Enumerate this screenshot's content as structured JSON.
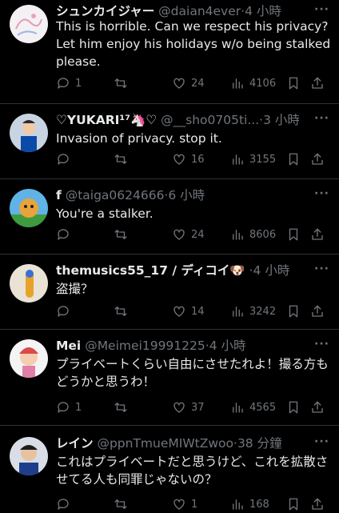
{
  "menu_glyph": "···",
  "tweets": [
    {
      "name": "シュンカイジャー",
      "handle": "@daian4ever",
      "sep": "·",
      "time": "4 小時",
      "text": "This is horrible. Can we respect his privacy? Let him enjoy his holidays w/o being stalked please.",
      "replies": "1",
      "retweets": "",
      "likes": "24",
      "views": "4106"
    },
    {
      "name": "♡YUKARI¹⁷🦄♡",
      "handle": "@__sho0705ti...",
      "sep": "·",
      "time": "3 小時",
      "text": "Invasion of privacy.  stop it.",
      "replies": "",
      "retweets": "",
      "likes": "16",
      "views": "3155"
    },
    {
      "name": "f",
      "handle": "@taiga0624666",
      "sep": "·",
      "time": "6 小時",
      "text": "You're a stalker.",
      "replies": "",
      "retweets": "",
      "likes": "24",
      "views": "8606"
    },
    {
      "name": "themusics55_17 / ディコイ🐶",
      "handle": "",
      "sep": "·",
      "time": "4 小時",
      "text": "盗撮？",
      "replies": "",
      "retweets": "",
      "likes": "14",
      "views": "3242"
    },
    {
      "name": "Mei",
      "handle": "@Meimei19991225",
      "sep": "·",
      "time": "4 小時",
      "text": "プライベートくらい自由にさせたれよ！撮る方もどうかと思うわ！",
      "replies": "1",
      "retweets": "",
      "likes": "37",
      "views": "4565"
    },
    {
      "name": "レイン",
      "handle": "@ppnTmueMIWtZwoo",
      "sep": "·",
      "time": "38 分鐘",
      "text": "これはプライベートだと思うけど、これを拡散させてる人も同罪じゃないの？",
      "replies": "",
      "retweets": "",
      "likes": "1",
      "views": "168"
    }
  ]
}
